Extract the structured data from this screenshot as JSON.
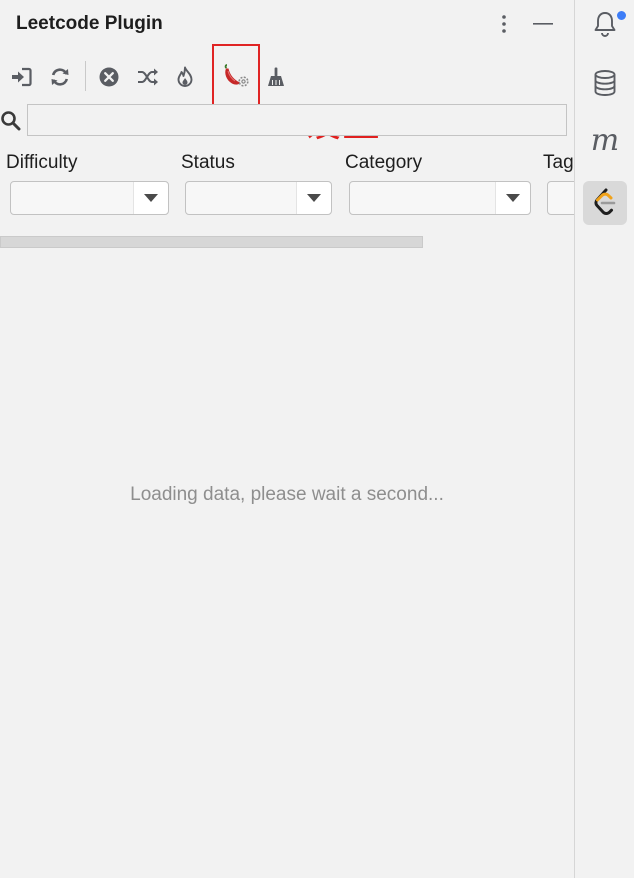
{
  "window": {
    "title": "Leetcode Plugin"
  },
  "toolbar": {
    "items": [
      {
        "icon": "sign-in-icon",
        "name": "login"
      },
      {
        "icon": "refresh-icon",
        "name": "refresh"
      },
      {
        "icon": "cancel-icon",
        "name": "cancel"
      },
      {
        "icon": "shuffle-icon",
        "name": "random"
      },
      {
        "icon": "fire-icon",
        "name": "hot"
      },
      {
        "icon": "pepper-settings-icon",
        "name": "settings"
      },
      {
        "icon": "broom-icon",
        "name": "clear"
      }
    ]
  },
  "annotation": {
    "text": "设置",
    "color": "#e0201f"
  },
  "search": {
    "value": "",
    "placeholder": ""
  },
  "filters": [
    {
      "label": "Difficulty",
      "value": ""
    },
    {
      "label": "Status",
      "value": ""
    },
    {
      "label": "Category",
      "value": ""
    },
    {
      "label": "Tags",
      "value": ""
    }
  ],
  "loading": {
    "message": "Loading data, please wait a second...",
    "progress": 0
  },
  "stripe": {
    "items": [
      {
        "icon": "notifications-icon",
        "name": "notifications",
        "has_badge": true
      },
      {
        "icon": "database-icon",
        "name": "database"
      },
      {
        "icon": "m-icon",
        "name": "m"
      },
      {
        "icon": "leetcode-icon",
        "name": "leetcode",
        "active": true
      }
    ]
  },
  "colors": {
    "background": "#f2f2f2",
    "highlight_box": "#e02424",
    "badge": "#3d7df7",
    "leetcode_orange": "#f0a21a"
  }
}
